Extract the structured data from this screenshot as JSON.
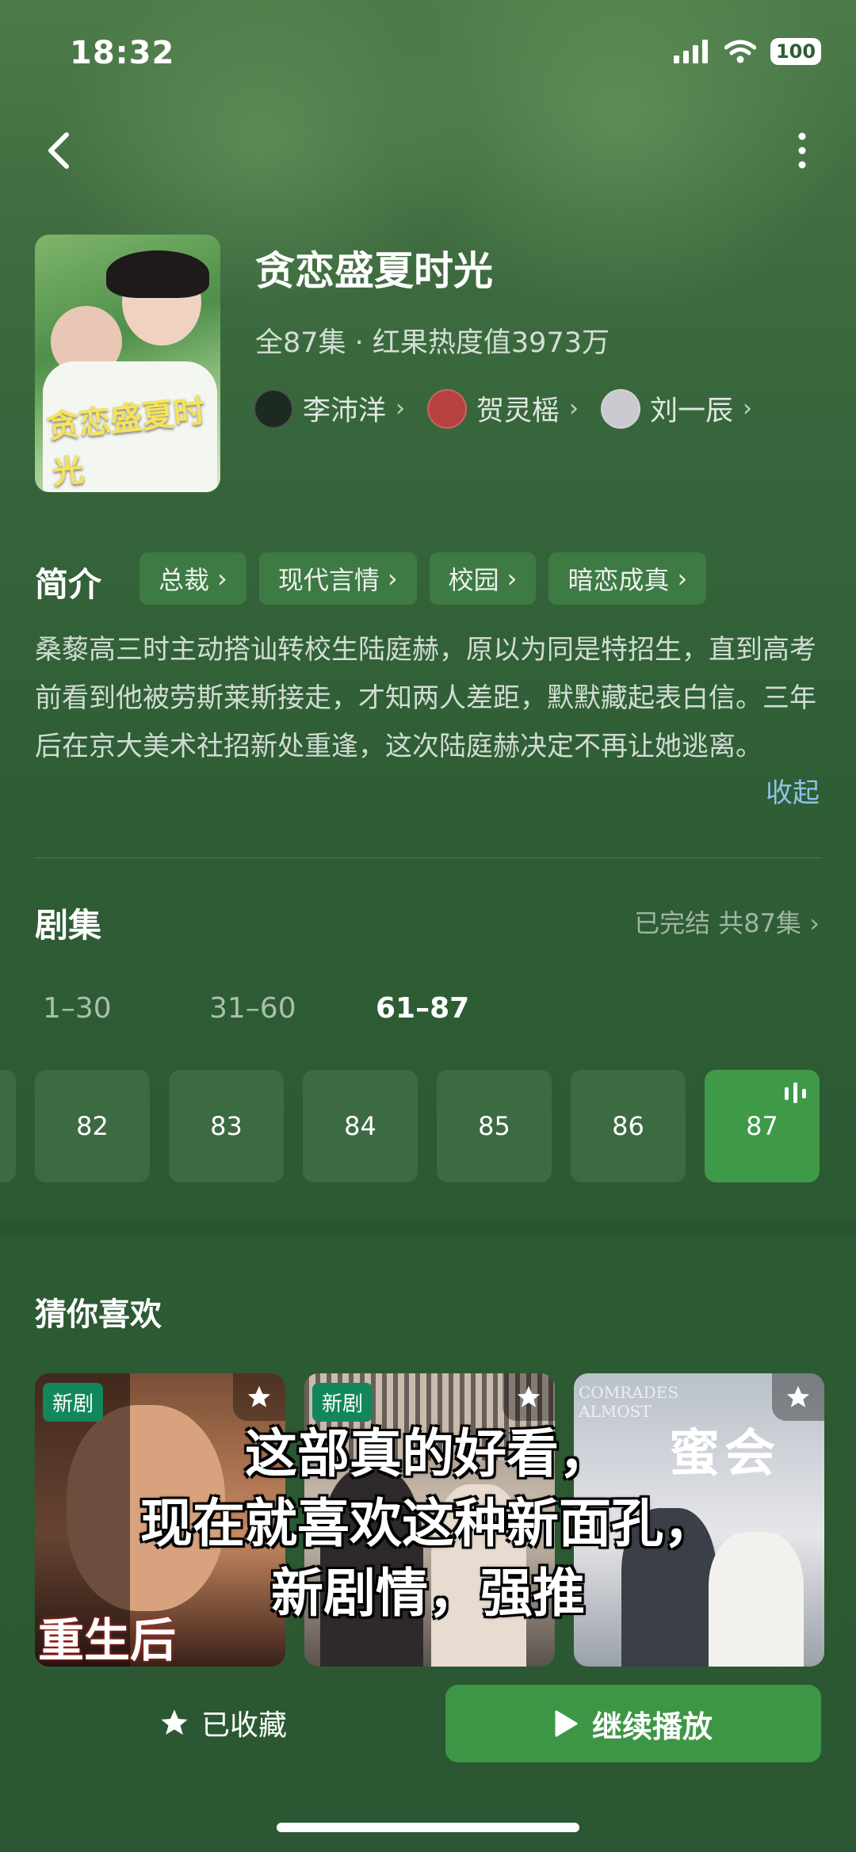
{
  "status_bar": {
    "time": "18:32",
    "battery": "100"
  },
  "drama": {
    "title": "贪恋盛夏时光",
    "meta": "全87集 · 红果热度值3973万",
    "poster_title": "贪恋盛夏时光",
    "cast": [
      {
        "name": "李沛洋"
      },
      {
        "name": "贺灵榣"
      },
      {
        "name": "刘一辰"
      }
    ]
  },
  "intro": {
    "heading": "简介",
    "tags": [
      "总裁",
      "现代言情",
      "校园",
      "暗恋成真"
    ],
    "description": "桑藜高三时主动搭讪转校生陆庭赫，原以为同是特招生，直到高考前看到他被劳斯莱斯接走，才知两人差距，默默藏起表白信。三年后在京大美术社招新处重逢，这次陆庭赫决定不再让她逃离。",
    "collapse_label": "收起"
  },
  "episodes": {
    "heading": "剧集",
    "status": "已完结 共87集",
    "ranges": [
      "1–30",
      "31–60",
      "61–87"
    ],
    "active_range": 2,
    "visible": [
      "82",
      "83",
      "84",
      "85",
      "86",
      "87"
    ],
    "current": "87"
  },
  "recommend": {
    "heading": "猜你喜欢",
    "items": [
      {
        "badge": "新剧",
        "poster_text": "重生后",
        "colors": [
          "#5a3a2a",
          "#c98b63"
        ]
      },
      {
        "badge": "新剧",
        "poster_text": "",
        "colors": [
          "#6b6560",
          "#c7b8a8"
        ]
      },
      {
        "badge": "",
        "poster_text": "蜜会",
        "overline": "COMRADES ALMOST",
        "colors": [
          "#a9b0b8",
          "#e8e8ea"
        ]
      }
    ]
  },
  "caption": {
    "lines": [
      "这部真的好看，",
      "现在就喜欢这种新面孔，",
      "新剧情，强推"
    ]
  },
  "bottom_bar": {
    "favorite_label": "已收藏",
    "play_label": "继续播放"
  },
  "colors": {
    "accent": "#3f9a48",
    "link": "#8fc3e8"
  }
}
